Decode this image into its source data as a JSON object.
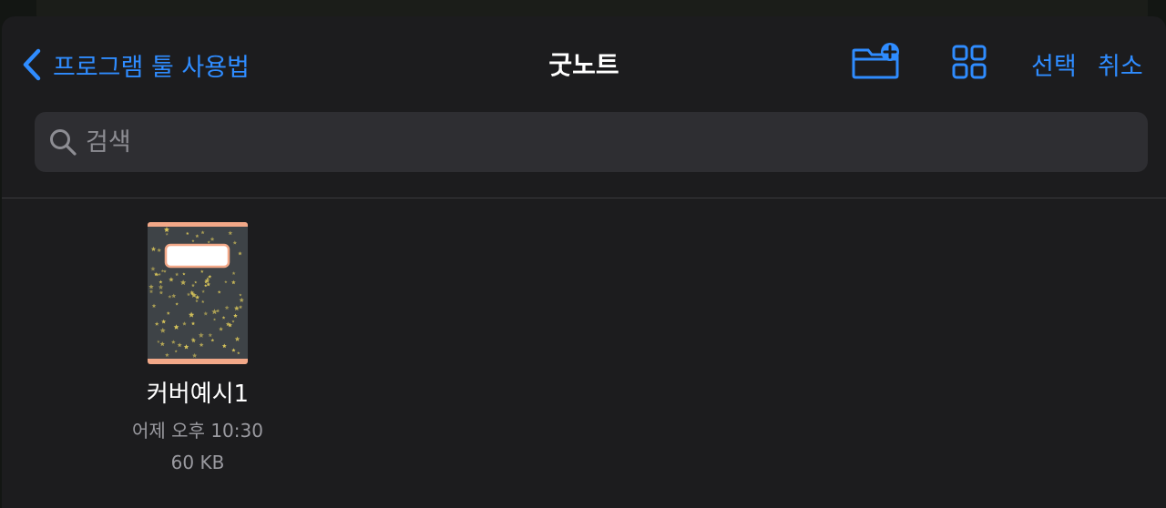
{
  "nav": {
    "back_label": "프로그램 툴 사용법",
    "title": "굿노트",
    "select_label": "선택",
    "cancel_label": "취소",
    "icons": [
      "chevron-left-icon",
      "new-folder-icon",
      "grid-view-icon"
    ]
  },
  "search": {
    "placeholder": "검색",
    "value": "",
    "icon": "search-icon"
  },
  "files": [
    {
      "name": "커버예시1",
      "date": "어제 오후 10:30",
      "size": "60 KB",
      "thumbnail": "notebook-cover-stars-thumbnail"
    }
  ],
  "colors": {
    "accent": "#2f8cff",
    "sheet_bg": "#1c1c1e",
    "search_bg": "#2e2e32",
    "cover_bg": "#3e4347",
    "cover_band": "#f2a888",
    "star": "#d8c55a"
  }
}
